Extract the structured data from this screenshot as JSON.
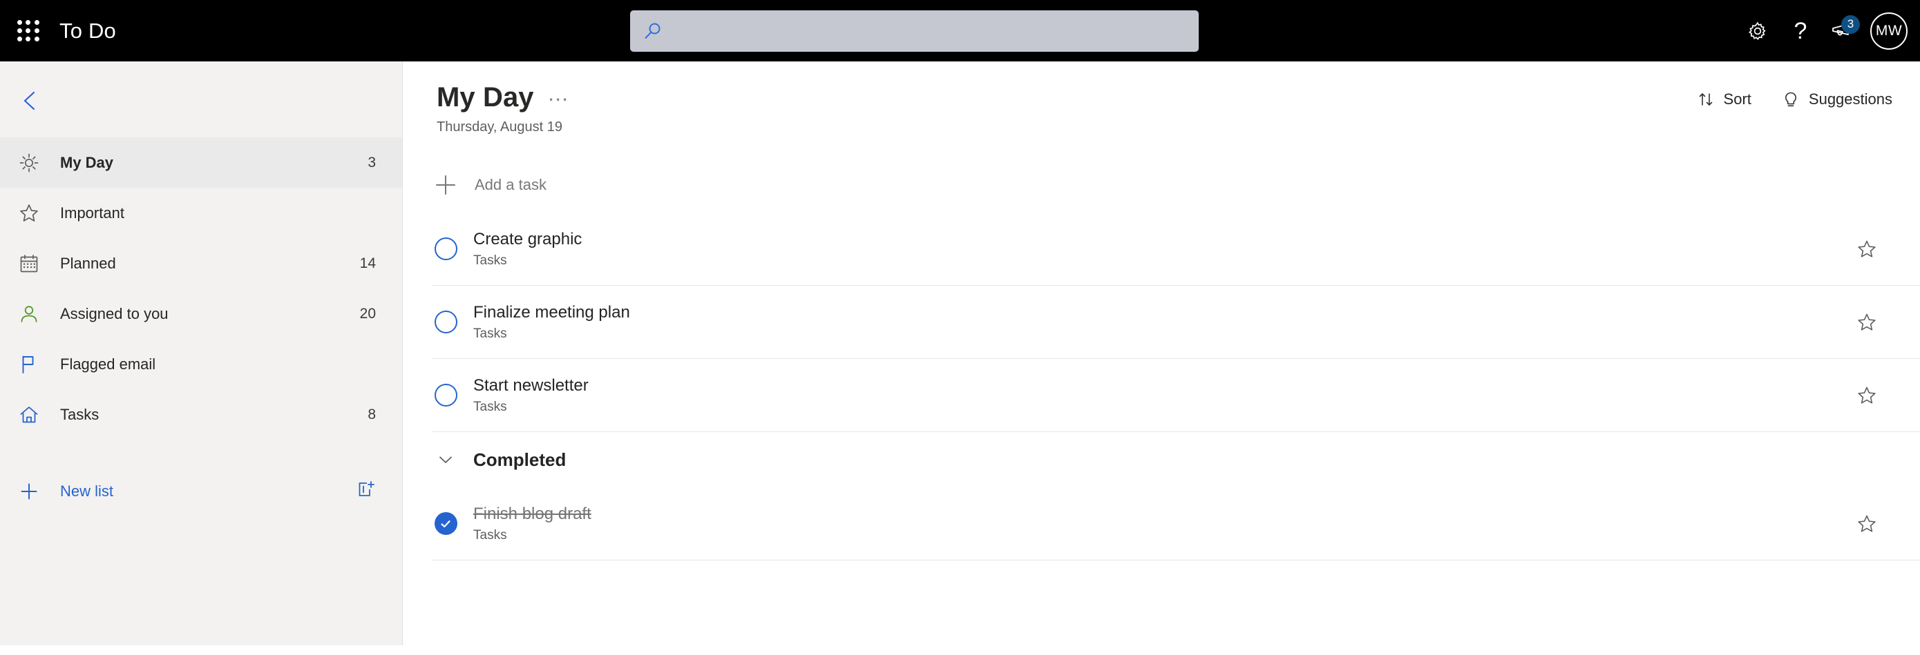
{
  "topbar": {
    "waffle_label": "app-launcher",
    "app_title": "To Do",
    "search": {
      "value": "",
      "placeholder": ""
    },
    "settings_label": "Settings",
    "help_label": "?",
    "notifications_badge": "3",
    "avatar_initials": "MW"
  },
  "sidebar": {
    "collapse_label": "Collapse navigation",
    "items": [
      {
        "label": "My Day",
        "count": "3",
        "icon": "sun-icon",
        "selected": true
      },
      {
        "label": "Important",
        "count": "",
        "icon": "star-icon",
        "selected": false
      },
      {
        "label": "Planned",
        "count": "14",
        "icon": "calendar-icon",
        "selected": false
      },
      {
        "label": "Assigned to you",
        "count": "20",
        "icon": "person-icon",
        "selected": false
      },
      {
        "label": "Flagged email",
        "count": "",
        "icon": "flag-icon",
        "selected": false
      },
      {
        "label": "Tasks",
        "count": "8",
        "icon": "home-icon",
        "selected": false
      }
    ],
    "new_list_label": "New list"
  },
  "main": {
    "page_title": "My Day",
    "page_date": "Thursday, August 19",
    "sort_label": "Sort",
    "suggestions_label": "Suggestions",
    "add_task_placeholder": "Add a task",
    "add_task_value": "",
    "tasks": [
      {
        "title": "Create graphic",
        "sub": "Tasks",
        "done": false
      },
      {
        "title": "Finalize meeting plan",
        "sub": "Tasks",
        "done": false
      },
      {
        "title": "Start newsletter",
        "sub": "Tasks",
        "done": false
      }
    ],
    "completed_section_label": "Completed",
    "completed_tasks": [
      {
        "title": "Finish blog draft",
        "sub": "Tasks",
        "done": true
      }
    ]
  },
  "colors": {
    "accent_blue": "#2564cf",
    "badge_blue": "#0f4f82",
    "green": "#4f9b28",
    "topbar_bg": "#000000",
    "sidebar_bg": "#f3f2f1",
    "selected_bg": "#eaeaea",
    "search_bg": "#c5c8d0"
  }
}
